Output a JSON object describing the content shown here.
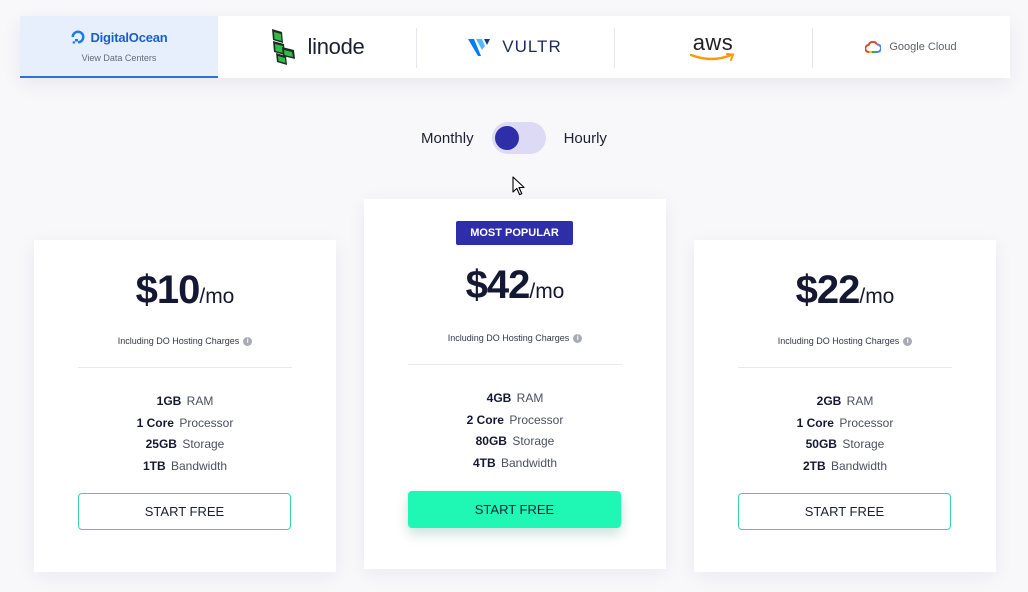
{
  "providers": [
    {
      "name": "DigitalOcean",
      "subtitle": "View Data Centers",
      "icon": "digitalocean-logo-icon",
      "active": true
    },
    {
      "name": "linode",
      "icon": "linode-logo-icon"
    },
    {
      "name": "VULTR",
      "icon": "vultr-logo-icon"
    },
    {
      "name": "aws",
      "icon": "aws-logo-icon"
    },
    {
      "name": "Google Cloud",
      "icon": "google-cloud-logo-icon"
    }
  ],
  "billing": {
    "left_label": "Monthly",
    "right_label": "Hourly",
    "selected": "Monthly"
  },
  "plans": [
    {
      "price": "$10",
      "period": "/mo",
      "note": "Including DO Hosting Charges",
      "specs": [
        {
          "value": "1GB",
          "label": "RAM"
        },
        {
          "value": "1 Core",
          "label": "Processor"
        },
        {
          "value": "25GB",
          "label": "Storage"
        },
        {
          "value": "1TB",
          "label": "Bandwidth"
        }
      ],
      "button": "START FREE"
    },
    {
      "badge": "MOST POPULAR",
      "price": "$42",
      "period": "/mo",
      "note": "Including DO Hosting Charges",
      "specs": [
        {
          "value": "4GB",
          "label": "RAM"
        },
        {
          "value": "2 Core",
          "label": "Processor"
        },
        {
          "value": "80GB",
          "label": "Storage"
        },
        {
          "value": "4TB",
          "label": "Bandwidth"
        }
      ],
      "button": "START FREE"
    },
    {
      "price": "$22",
      "period": "/mo",
      "note": "Including DO Hosting Charges",
      "specs": [
        {
          "value": "2GB",
          "label": "RAM"
        },
        {
          "value": "1 Core",
          "label": "Processor"
        },
        {
          "value": "50GB",
          "label": "Storage"
        },
        {
          "value": "2TB",
          "label": "Bandwidth"
        }
      ],
      "button": "START FREE"
    }
  ],
  "colors": {
    "accent": "#2e2ea8",
    "cta": "#1ff7b5",
    "outline": "#3ad3b0",
    "digitalocean_blue": "#1b5ecb"
  }
}
